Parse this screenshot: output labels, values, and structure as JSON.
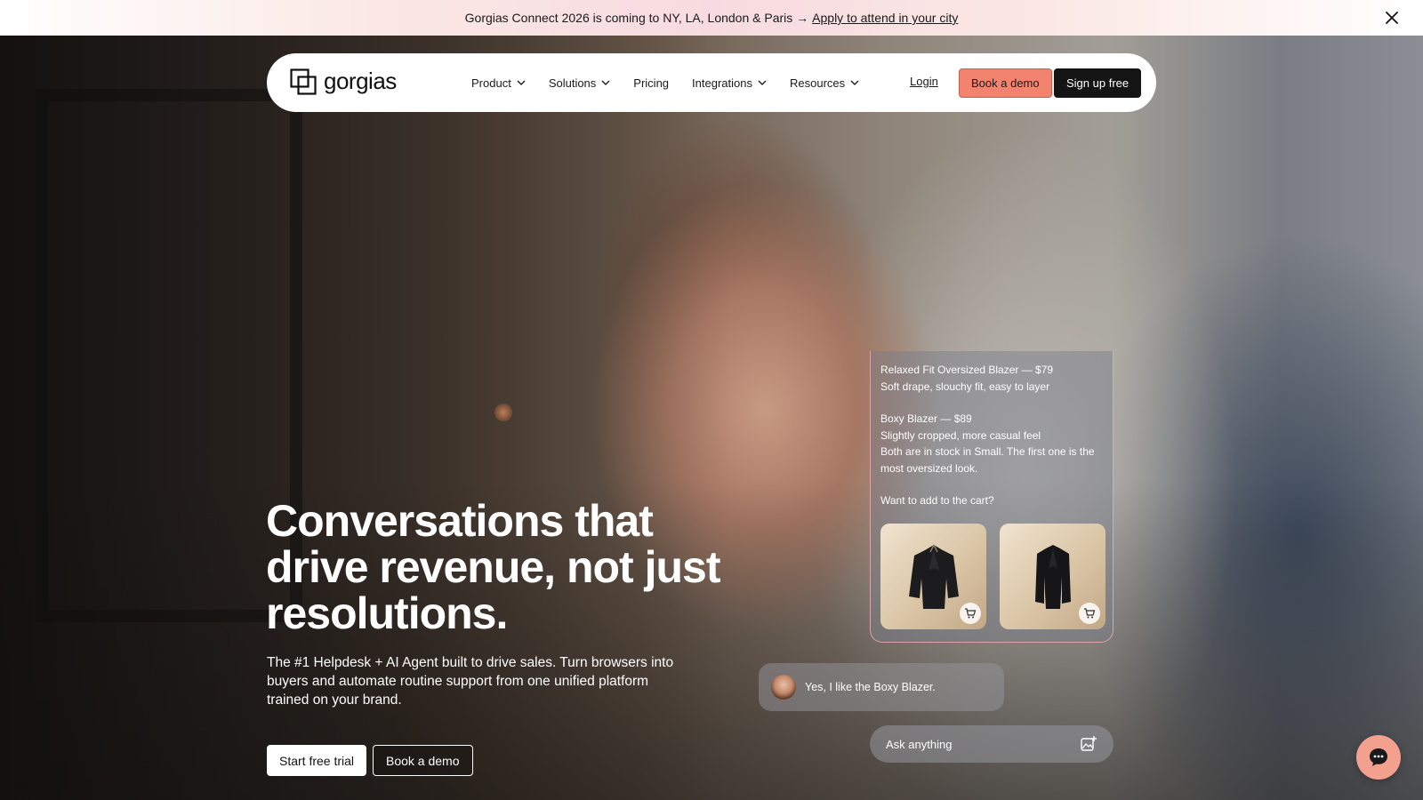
{
  "announcement": {
    "message": "Gorgias Connect 2026 is coming to NY, LA, London & Paris →",
    "link_text": "Apply to attend in your city",
    "close_icon": "close-icon"
  },
  "nav": {
    "logo_text": "gorgias",
    "items": [
      {
        "label": "Product",
        "dropdown": true
      },
      {
        "label": "Solutions",
        "dropdown": true
      },
      {
        "label": "Pricing",
        "dropdown": false
      },
      {
        "label": "Integrations",
        "dropdown": true
      },
      {
        "label": "Resources",
        "dropdown": true
      }
    ],
    "login": "Login",
    "book_demo": "Book a demo",
    "sign_up": "Sign up free"
  },
  "hero": {
    "headline": "Conversations that drive revenue, not just resolutions.",
    "subtext": "The #1 Helpdesk + AI Agent built to drive sales. Turn browsers into buyers and automate routine support from one unified platform trained on your brand.",
    "cta_primary": "Start free trial",
    "cta_secondary": "Book a demo"
  },
  "chat": {
    "product1_title": "Relaxed Fit Oversized Blazer — $79",
    "product1_desc": "Soft drape, slouchy fit, easy to layer",
    "product2_title": "Boxy Blazer — $89",
    "product2_desc": "Slightly cropped, more casual feel",
    "stock_note": "Both are in stock in Small. The first one is the most oversized look.",
    "question": "Want to add to the cart?",
    "user_message": "Yes, I like the Boxy Blazer.",
    "input_placeholder": "Ask anything"
  },
  "colors": {
    "accent": "#f2846f",
    "dark_button": "#141414",
    "card_border": "#f0aaaf"
  }
}
